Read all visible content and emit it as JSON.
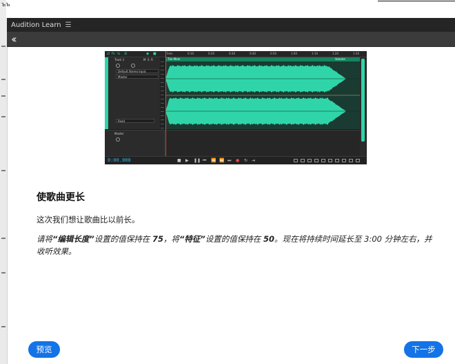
{
  "window": {
    "top_left_text": "ъъ"
  },
  "panel": {
    "title": "Audition Learn",
    "menu_icon": "hamburger-icon",
    "back_icon": "double-chevron-left-icon"
  },
  "preview": {
    "time": "0:00.000",
    "ruler": [
      "hms",
      "0:10",
      "0:20",
      "0:30",
      "0:40",
      "0:50",
      "1:00",
      "1:10",
      "1:20",
      "1:30"
    ],
    "track_name": "Track 1",
    "track_input": "Default Stereo Input",
    "track_output": "Master",
    "track_mode": "Read",
    "master_name": "Master",
    "clip_name": "The Mole",
    "clip_volume": "Volume",
    "wave_color": "#2fd5a8",
    "accent_color": "#1473e6"
  },
  "lesson": {
    "title": "使歌曲更长",
    "intro": "这次我们想让歌曲比以前长。",
    "instruction": {
      "p1": "请将",
      "k1": "“编辑长度”",
      "p2": "设置的值保持在 ",
      "v1": "75",
      "p3": "，将",
      "k2": "“特征”",
      "p4": "设置的值保持在 ",
      "v2": "50",
      "p5": "。现在将持续时间延长至 3:00 分钟左右，并收听效果。"
    }
  },
  "footer": {
    "preview_label": "预览",
    "next_label": "下一步"
  }
}
